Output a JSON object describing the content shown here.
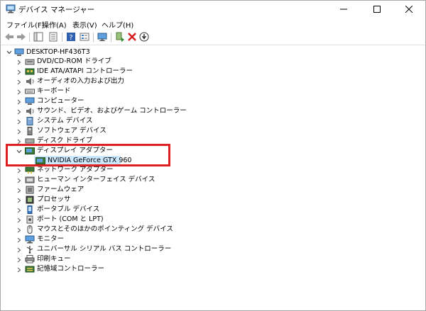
{
  "window": {
    "title": "デバイス マネージャー",
    "min_glyph": "—",
    "max_glyph": "☐",
    "close_glyph": "✕"
  },
  "menu": [
    {
      "label": "ファイル(F)"
    },
    {
      "label": "操作(A)"
    },
    {
      "label": "表示(V)"
    },
    {
      "label": "ヘルプ(H)"
    }
  ],
  "toolbar": {
    "icons": [
      "back-arrow-icon",
      "forward-arrow-icon",
      "show-hide-console-tree-icon",
      "properties-icon",
      "help-icon",
      "device-list-view-icon",
      "monitor-icon",
      "update-driver-icon",
      "uninstall-device-icon",
      "scan-hardware-changes-icon"
    ]
  },
  "tree": {
    "root": "DESKTOP-HF436T3",
    "categories": [
      {
        "label": "DVD/CD-ROM ドライブ",
        "icon": "dvd-drive-icon"
      },
      {
        "label": "IDE ATA/ATAPI コントローラー",
        "icon": "ide-controller-icon"
      },
      {
        "label": "オーディオの入力および出力",
        "icon": "audio-icon"
      },
      {
        "label": "キーボード",
        "icon": "keyboard-icon"
      },
      {
        "label": "コンピューター",
        "icon": "computer-icon"
      },
      {
        "label": "サウンド、ビデオ、およびゲーム コントローラー",
        "icon": "sound-icon"
      },
      {
        "label": "システム デバイス",
        "icon": "system-device-icon"
      },
      {
        "label": "ソフトウェア デバイス",
        "icon": "software-device-icon"
      },
      {
        "label": "ディスク ドライブ",
        "icon": "disk-drive-icon"
      },
      {
        "label": "ディスプレイ アダプター",
        "icon": "display-adapter-icon",
        "expanded": true,
        "children": [
          {
            "label": "NVIDIA GeForce GTX 960",
            "icon": "display-adapter-icon"
          }
        ]
      },
      {
        "label": "ネットワーク アダプター",
        "icon": "network-adapter-icon"
      },
      {
        "label": "ヒューマン インターフェイス デバイス",
        "icon": "hid-icon"
      },
      {
        "label": "ファームウェア",
        "icon": "firmware-icon"
      },
      {
        "label": "プロセッサ",
        "icon": "processor-icon"
      },
      {
        "label": "ポータブル デバイス",
        "icon": "portable-device-icon"
      },
      {
        "label": "ポート (COM と LPT)",
        "icon": "port-icon"
      },
      {
        "label": "マウスとそのほかのポインティング デバイス",
        "icon": "mouse-icon"
      },
      {
        "label": "モニター",
        "icon": "monitor-icon"
      },
      {
        "label": "ユニバーサル シリアル バス コントローラー",
        "icon": "usb-icon"
      },
      {
        "label": "印刷キュー",
        "icon": "printer-icon"
      },
      {
        "label": "記憶域コントローラー",
        "icon": "storage-controller-icon"
      }
    ]
  },
  "colors": {
    "selection": "#cce8ff",
    "highlight_border": "#e02020"
  }
}
